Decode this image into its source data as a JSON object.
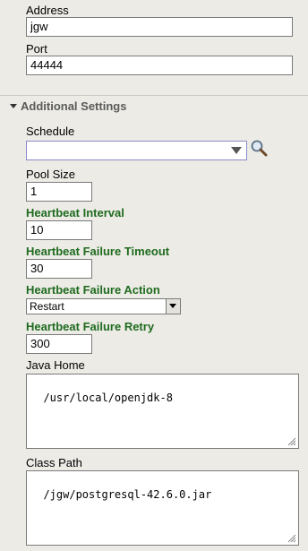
{
  "address": {
    "label": "Address",
    "value": "jgw"
  },
  "port": {
    "label": "Port",
    "value": "44444"
  },
  "additional_settings": {
    "title": "Additional Settings",
    "schedule": {
      "label": "Schedule",
      "value": "",
      "lookup_icon": "search-icon"
    },
    "pool_size": {
      "label": "Pool Size",
      "value": "1"
    },
    "heartbeat_interval": {
      "label": "Heartbeat Interval",
      "value": "10"
    },
    "heartbeat_failure_timeout": {
      "label": "Heartbeat Failure Timeout",
      "value": "30"
    },
    "heartbeat_failure_action": {
      "label": "Heartbeat Failure Action",
      "value": "Restart"
    },
    "heartbeat_failure_retry": {
      "label": "Heartbeat Failure Retry",
      "value": "300"
    },
    "java_home": {
      "label": "Java Home",
      "value": "/usr/local/openjdk-8"
    },
    "class_path": {
      "label": "Class Path",
      "value": "/jgw/postgresql-42.6.0.jar"
    }
  },
  "colors": {
    "background": "#ecebe6",
    "required_label": "#1f6b1f",
    "section_heading": "#5a5a5a"
  }
}
